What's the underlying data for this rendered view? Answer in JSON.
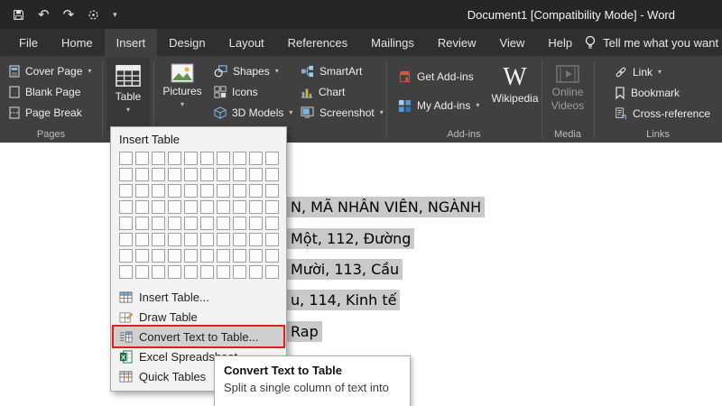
{
  "titlebar": {
    "title": "Document1 [Compatibility Mode] -  Word"
  },
  "tabs": [
    {
      "label": "File"
    },
    {
      "label": "Home"
    },
    {
      "label": "Insert"
    },
    {
      "label": "Design"
    },
    {
      "label": "Layout"
    },
    {
      "label": "References"
    },
    {
      "label": "Mailings"
    },
    {
      "label": "Review"
    },
    {
      "label": "View"
    },
    {
      "label": "Help"
    }
  ],
  "tell_me": "Tell me what you want to d",
  "groups": {
    "pages": {
      "label": "Pages",
      "cover_page": "Cover Page",
      "blank_page": "Blank Page",
      "page_break": "Page Break"
    },
    "table_button": "Table",
    "pictures": "Pictures",
    "shapes": "Shapes",
    "icons": "Icons",
    "models3d": "3D Models",
    "smartart": "SmartArt",
    "chart": "Chart",
    "screenshot": "Screenshot",
    "addins": {
      "label": "Add-ins",
      "get_addins": "Get Add-ins",
      "my_addins": "My Add-ins",
      "w_glyph": "W",
      "wikipedia": "Wikipedia"
    },
    "media": {
      "label": "Media",
      "online_line1": "Online",
      "online_line2": "Videos"
    },
    "links": {
      "label": "Links",
      "link": "Link",
      "bookmark": "Bookmark",
      "cross_reference": "Cross-reference"
    }
  },
  "table_menu": {
    "header": "Insert Table",
    "grid": {
      "rows": 8,
      "cols": 10
    },
    "items": [
      {
        "label": "Insert Table..."
      },
      {
        "label": "Draw Table"
      },
      {
        "label": "Convert Text to Table..."
      },
      {
        "label": "Excel Spreadsheet"
      },
      {
        "label": "Quick Tables"
      }
    ]
  },
  "tooltip": {
    "title": "Convert Text to Table",
    "body": "Split a single column of text into"
  },
  "document": {
    "lines": [
      {
        "text": "N, MÃ NHÂN VIÊN, NGÀNH"
      },
      {
        "text": "Một, 112, Đường"
      },
      {
        "text": "Mười, 113, Cầu"
      },
      {
        "text": "u, 114, Kinh tế"
      },
      {
        "text": "Rap"
      }
    ]
  },
  "colors": {
    "accent_red": "#e01f1f",
    "selection_gray": "#c9c9c9",
    "titlebar": "#262626",
    "ribbon": "#404040"
  }
}
